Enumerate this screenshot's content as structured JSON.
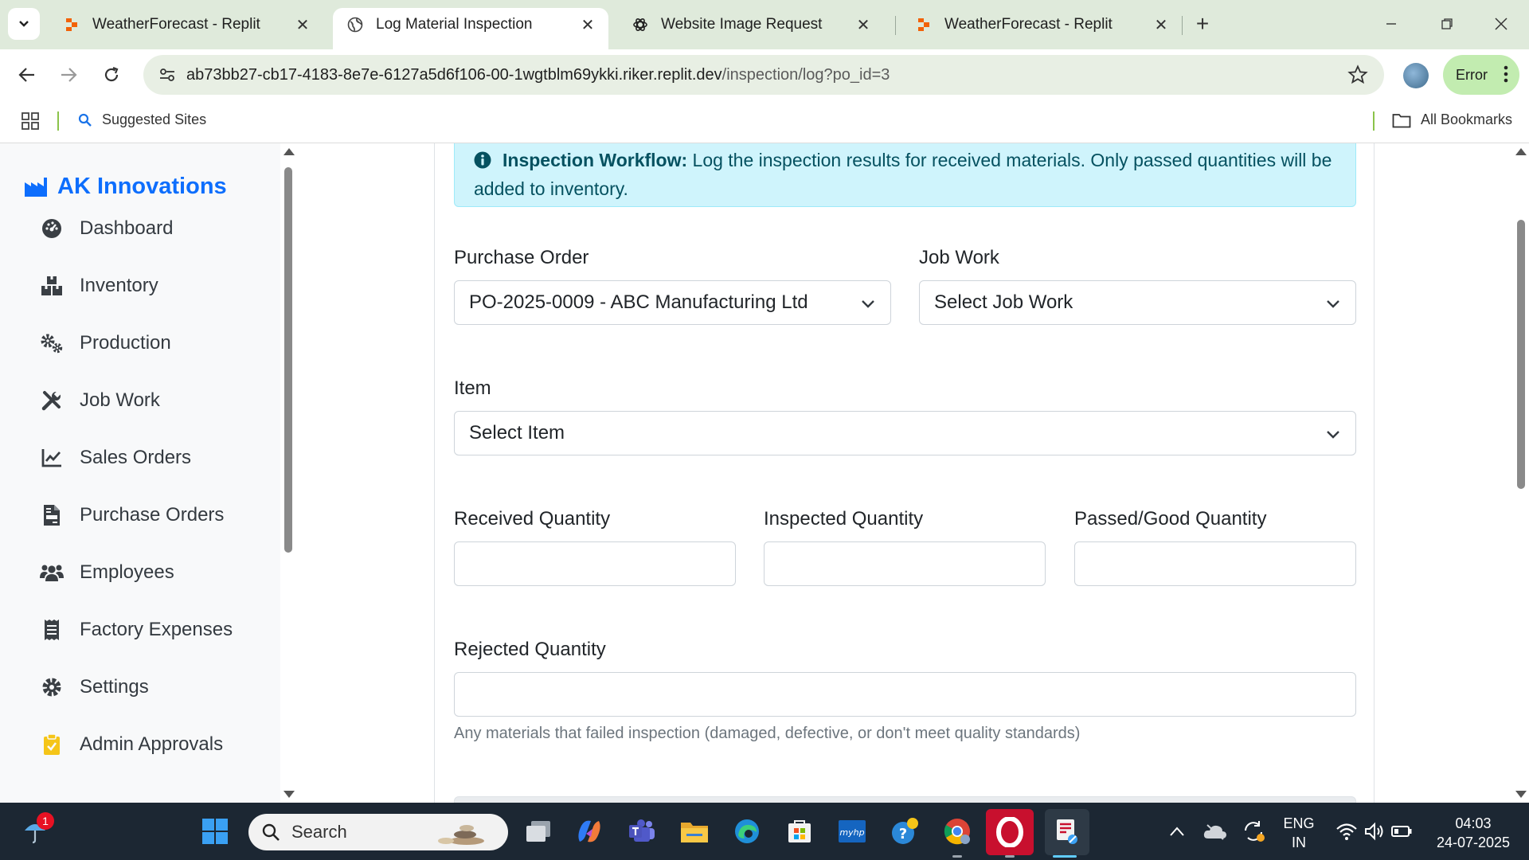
{
  "browser": {
    "tabs": [
      {
        "title": "WeatherForecast - Replit",
        "favicon": "replit-icon",
        "active": false
      },
      {
        "title": "Log Material Inspection",
        "favicon": "globe-icon",
        "active": true
      },
      {
        "title": "Website Image Request",
        "favicon": "openai-icon",
        "active": false
      },
      {
        "title": "WeatherForecast - Replit",
        "favicon": "replit-icon",
        "active": false
      }
    ],
    "url_host": "ab73bb27-cb17-4183-8e7e-6127a5d6f106-00-1wgtblm69ykki.riker.replit.dev",
    "url_path": "/inspection/log?po_id=3",
    "profile_status": "Error",
    "bookmarks": {
      "suggested": "Suggested Sites",
      "all": "All Bookmarks"
    }
  },
  "sidebar": {
    "brand": "AK Innovations",
    "items": [
      {
        "label": "Dashboard",
        "icon": "dashboard-gauge-icon"
      },
      {
        "label": "Inventory",
        "icon": "boxes-icon"
      },
      {
        "label": "Production",
        "icon": "cogs-icon"
      },
      {
        "label": "Job Work",
        "icon": "tools-icon"
      },
      {
        "label": "Sales Orders",
        "icon": "line-chart-icon"
      },
      {
        "label": "Purchase Orders",
        "icon": "invoice-icon"
      },
      {
        "label": "Employees",
        "icon": "users-icon"
      },
      {
        "label": "Factory Expenses",
        "icon": "receipt-icon"
      },
      {
        "label": "Settings",
        "icon": "gear-icon"
      },
      {
        "label": "Admin Approvals",
        "icon": "clipboard-check-icon"
      }
    ]
  },
  "form": {
    "alert_title": "Inspection Workflow:",
    "alert_text": "Log the inspection results for received materials. Only passed quantities will be added to inventory.",
    "purchase_order_label": "Purchase Order",
    "purchase_order_value": "PO-2025-0009 - ABC Manufacturing Ltd",
    "job_work_label": "Job Work",
    "job_work_value": "Select Job Work",
    "item_label": "Item",
    "item_value": "Select Item",
    "received_label": "Received Quantity",
    "received_value": "",
    "inspected_label": "Inspected Quantity",
    "inspected_value": "",
    "passed_label": "Passed/Good Quantity",
    "passed_value": "",
    "rejected_label": "Rejected Quantity",
    "rejected_value": "",
    "rejected_help": "Any materials that failed inspection (damaged, defective, or don't meet quality standards)"
  },
  "taskbar": {
    "search_placeholder": "Search",
    "notification_count": "1",
    "language_line1": "ENG",
    "language_line2": "IN",
    "time": "04:03",
    "date": "24-07-2025"
  },
  "colors": {
    "brand": "#0d6efd",
    "alert_bg": "#cff4fc",
    "alert_text": "#055160",
    "chrome_bg": "#dfeadb",
    "error_pill": "#c2ecb0"
  }
}
